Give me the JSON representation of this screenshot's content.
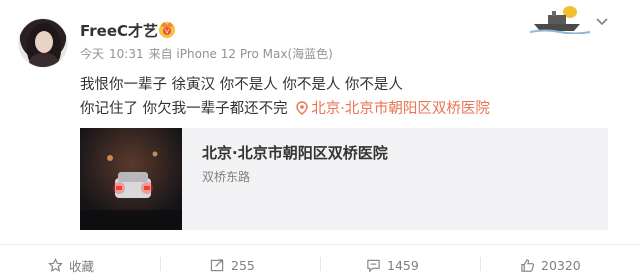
{
  "post": {
    "username": "FreeC才艺",
    "meta": {
      "date": "今天",
      "time": "10:31",
      "source": "来自 iPhone 12 Pro Max(海蓝色)"
    },
    "text_line1": "我恨你一辈子 徐寅汉 你不是人 你不是人 你不是人",
    "text_line2": "你记住了 你欠我一辈子都还不完",
    "location_link": "北京·北京市朝阳区双桥医院",
    "location_card": {
      "title": "北京·北京市朝阳区双桥医院",
      "subtitle": "双桥东路"
    }
  },
  "actions": {
    "favorite_label": "收藏",
    "repost_count": "255",
    "comment_count": "1459",
    "like_count": "20320"
  },
  "colors": {
    "link": "#eb7350",
    "gray": "#808080"
  }
}
